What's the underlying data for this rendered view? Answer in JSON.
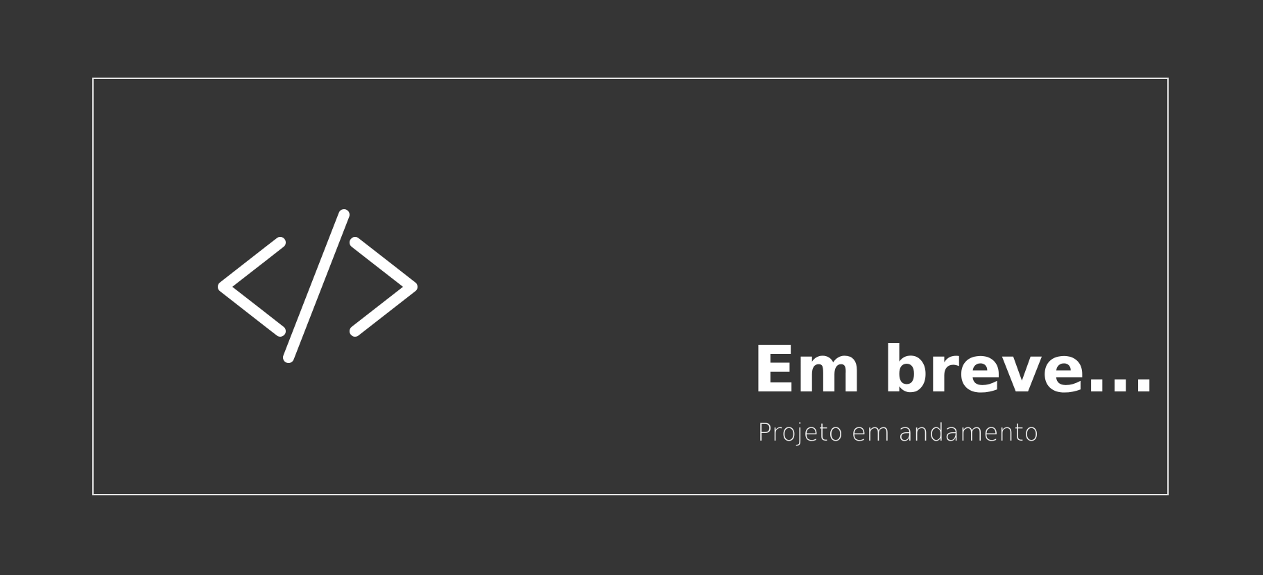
{
  "colors": {
    "background": "#353535",
    "frame_border": "#e6e6e6",
    "text": "#ffffff"
  },
  "icon": "code-icon",
  "heading": {
    "title": "Em breve...",
    "subtitle": "Projeto em andamento"
  }
}
